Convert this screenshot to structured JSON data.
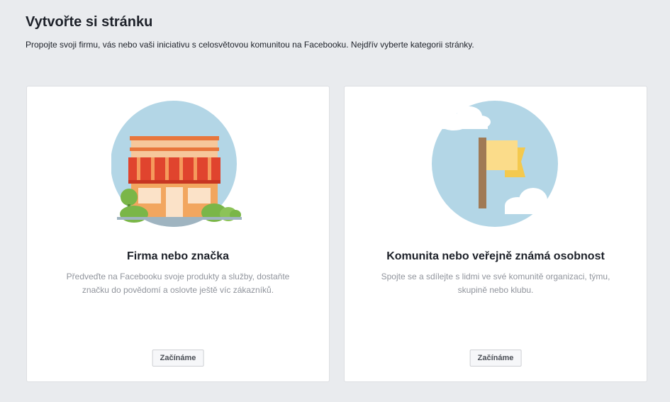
{
  "header": {
    "title": "Vytvořte si stránku",
    "subtitle": "Propojte svoji firmu, vás nebo vaši iniciativu s celosvětovou komunitou na Facebooku. Nejdřív vyberte kategorii stránky."
  },
  "cards": [
    {
      "icon": "storefront-illustration",
      "title": "Firma nebo značka",
      "description": "Předveďte na Facebooku svoje produkty a služby, dostaňte značku do povědomí a oslovte ještě víc zákazníků.",
      "button_label": "Začínáme"
    },
    {
      "icon": "flag-illustration",
      "title": "Komunita nebo veřejně známá osobnost",
      "description": "Spojte se a sdílejte s lidmi ve své komunitě organizaci, týmu, skupině nebo klubu.",
      "button_label": "Začínáme"
    }
  ],
  "colors": {
    "background": "#e9ebee",
    "circle": "#b3d6e6",
    "awning_red": "#e0442e",
    "building_orange": "#f2a65f",
    "tree_green": "#7ab648",
    "flag_yellow": "#fbdc8a",
    "flag_pole": "#a07a55"
  }
}
